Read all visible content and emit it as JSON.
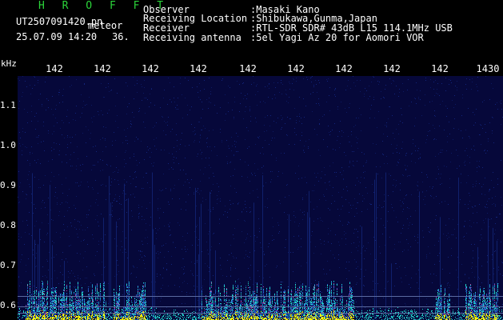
{
  "header": {
    "logo": "H R O F F T",
    "filename": "UT2507091420.pn",
    "mode": "meteor",
    "datetime": "25.07.09 14:20",
    "counter": "36.",
    "info": [
      {
        "label": "Observer",
        "value": ":Masaki Kano"
      },
      {
        "label": "Receiving Location",
        "value": ":Shibukawa,Gunma,Japan"
      },
      {
        "label": "Receiver",
        "value": ":RTL-SDR SDR# 43dB L15 114.1MHz USB"
      },
      {
        "label": "Receiving antenna",
        "value": ":5el Yagi Az 20 for Aomori VOR"
      }
    ]
  },
  "axis": {
    "unit": "kHz",
    "top_ticks": [
      "142",
      "142",
      "142",
      "142",
      "142",
      "142",
      "142",
      "142",
      "142",
      "1430"
    ],
    "left_ticks": [
      "1.1",
      "1.0",
      "0.9",
      "0.8",
      "0.7",
      "0.6"
    ]
  },
  "colors": {
    "background": "#06083a",
    "text": "#ffffff",
    "logo": "#2bd43a",
    "signal_low": "#2c58c8",
    "signal_mid": "#22d0c8",
    "signal_high": "#ffff00"
  }
}
